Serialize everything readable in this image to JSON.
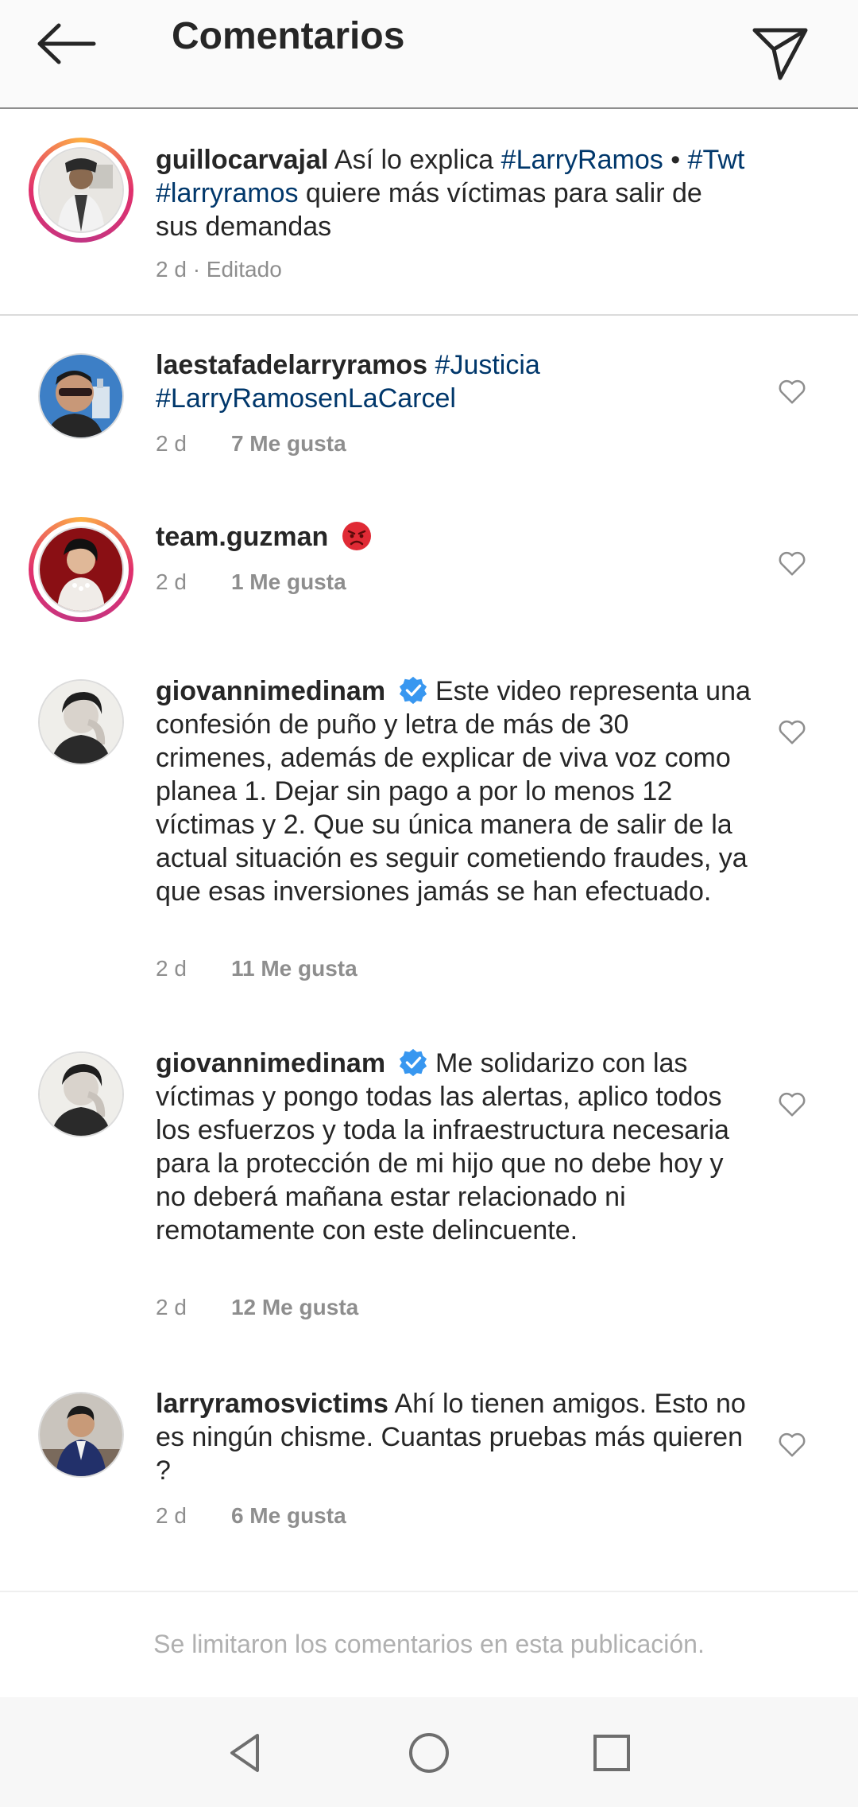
{
  "header": {
    "title": "Comentarios"
  },
  "caption": {
    "username": "guillocarvajal",
    "text_1": " Así lo explica ",
    "tag_1": "#LarryRamos",
    "sep": " • ",
    "tag_2": "#Twt",
    "tag_3": "#larryramos",
    "text_2": " quiere más víctimas para salir de sus demandas",
    "time": "2 d · Editado"
  },
  "comments": [
    {
      "username": "laestafadelarryramos",
      "tag_1": " #Justicia",
      "tag_2": "#LarryRamosenLaCarcel",
      "time": "2 d",
      "likes": "7 Me gusta"
    },
    {
      "username": "team.guzman",
      "emoji": "angry-face",
      "time": "2 d",
      "likes": "1 Me gusta"
    },
    {
      "username": "giovannimedinam",
      "verified": true,
      "text": " Este video representa una confesión de puño y letra de más de 30 crimenes, además de explicar de viva voz como planea 1. Dejar sin pago a por lo menos 12 víctimas y 2. Que su única manera de salir de la actual situación es seguir cometiendo fraudes, ya que esas inversiones jamás se han efectuado.",
      "time": "2 d",
      "likes": "11 Me gusta"
    },
    {
      "username": "giovannimedinam",
      "verified": true,
      "text": " Me solidarizo con las víctimas y pongo todas las alertas, aplico todos los esfuerzos y toda la infraestructura necesaria para la protección de mi hijo que no debe hoy y no deberá mañana estar relacionado ni remotamente con este delincuente.",
      "time": "2 d",
      "likes": "12 Me gusta"
    },
    {
      "username": "larryramosvictims",
      "text": " Ahí lo tienen amigos. Esto no es ningún chisme. Cuantas pruebas más quieren ?",
      "time": "2 d",
      "likes": "6 Me gusta"
    }
  ],
  "footer": {
    "limited_text": "Se limitaron los comentarios en esta publicación."
  },
  "colors": {
    "hashtag": "#00376b",
    "verified": "#3897f0",
    "meta": "#8e8e8e"
  },
  "icons": [
    "back-arrow-icon",
    "direct-send-icon",
    "heart-outline-icon",
    "verified-badge-icon",
    "nav-back-icon",
    "nav-home-icon",
    "nav-recents-icon"
  ]
}
